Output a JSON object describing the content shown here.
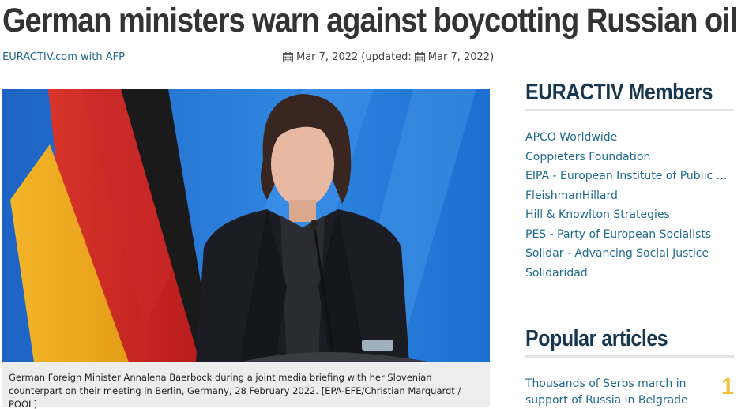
{
  "article": {
    "headline": "German ministers warn against boycotting Russian oil",
    "byline": "EURACTIV.com with AFP",
    "published": "Mar 7, 2022",
    "updated_prefix": "(updated:",
    "updated": "Mar 7, 2022)",
    "caption": "German Foreign Minister Annalena Baerbock during a joint media briefing with her Slovenian counterpart on their meeting in Berlin, Germany, 28 February 2022. [EPA-EFE/Christian Marquardt / POOL]",
    "hero_icon": "photo-of-minister-at-podium"
  },
  "sidebar": {
    "members_heading": "EURACTIV Members",
    "members": [
      "APCO Worldwide",
      "Coppieters Foundation",
      "EIPA - European Institute of Public Administration",
      "FleishmanHillard",
      "Hill & Knowlton Strategies",
      "PES - Party of European Socialists",
      "Solidar - Advancing Social Justice",
      "Solidaridad"
    ],
    "popular_heading": "Popular articles",
    "popular": [
      {
        "title": "Thousands of Serbs march in support of Russia in Belgrade",
        "rank": "1"
      }
    ]
  },
  "icons": {
    "calendar": "calendar-icon"
  },
  "colors": {
    "headline": "#333333",
    "link": "#1f6a8c",
    "sidebar_heading": "#16374f",
    "rank": "#f0c23c",
    "caption_bg": "#ededed"
  }
}
